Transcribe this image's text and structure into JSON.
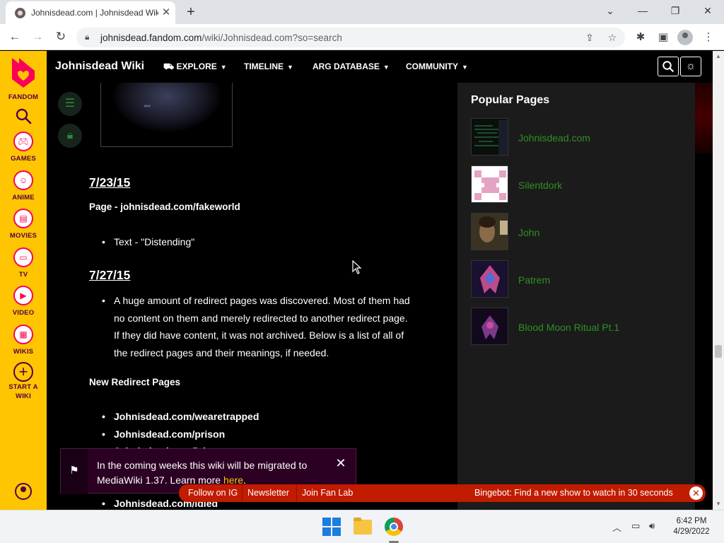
{
  "browser": {
    "tab_title": "Johnisdead.com | Johnisdead Wiki",
    "url_host": "johnisdead.fandom.com",
    "url_path": "/wiki/Johnisdead.com?so=search",
    "icons": [
      "back-icon",
      "forward-icon",
      "reload-icon",
      "lock-icon",
      "share-icon",
      "star-icon",
      "extensions-icon",
      "sidepanel-icon",
      "profile-icon",
      "menu-icon"
    ]
  },
  "rail": {
    "brand": "FANDOM",
    "items": [
      {
        "label": "GAMES",
        "icon": "gamepad-icon"
      },
      {
        "label": "ANIME",
        "icon": "anime-icon"
      },
      {
        "label": "MOVIES",
        "icon": "film-icon"
      },
      {
        "label": "TV",
        "icon": "tv-icon"
      },
      {
        "label": "VIDEO",
        "icon": "play-icon"
      },
      {
        "label": "WIKIS",
        "icon": "book-icon"
      }
    ],
    "start_wiki_line1": "START A",
    "start_wiki_line2": "WIKI"
  },
  "header": {
    "wiki_name": "Johnisdead Wiki",
    "nav": [
      {
        "label": "EXPLORE"
      },
      {
        "label": "TIMELINE"
      },
      {
        "label": "ARG DATABASE"
      },
      {
        "label": "COMMUNITY"
      }
    ]
  },
  "content": {
    "thumb_text": "...",
    "section1": {
      "date": "7/23/15",
      "page_label": "Page - johnisdead.com/fakeworld",
      "bullet": "Text - \"Distending\""
    },
    "section2": {
      "date": "7/27/15",
      "bullet_lines": [
        "A huge amount of redirect pages was discovered. Most of them had",
        "no content on them and merely redirected to another redirect page.",
        "If they did have content, it was not archived. Below is a list of all of",
        "the redirect pages and their meanings, if needed."
      ]
    },
    "redirect_heading": "New Redirect Pages",
    "redirects": [
      "Johnisdead.com/wearetrapped",
      "Johnisdead.com/prison",
      "Johnisdead.com/ialone",
      "Johnisdead.com/idied"
    ]
  },
  "popular": {
    "title": "Popular Pages",
    "items": [
      {
        "label": "Johnisdead.com"
      },
      {
        "label": "Silentdork"
      },
      {
        "label": "John"
      },
      {
        "label": "Patrem"
      },
      {
        "label": "Blood Moon Ritual Pt.1"
      }
    ]
  },
  "migration": {
    "text": "In the coming weeks this wiki will be migrated to MediaWiki 1.37. Learn more ",
    "link": "here",
    "suffix": "."
  },
  "promo": {
    "follow": "Follow on IG",
    "newsletter": "Newsletter",
    "fanlab": "Join Fan Lab",
    "bingebot": "Bingebot: Find a new show to watch in 30 seconds"
  },
  "taskbar": {
    "time": "6:42 PM",
    "date": "4/29/2022"
  },
  "colors": {
    "fandom_yellow": "#ffc500",
    "fandom_pink": "#fa005a",
    "link_green": "#2f8f24",
    "promo_red": "#c11b00"
  }
}
